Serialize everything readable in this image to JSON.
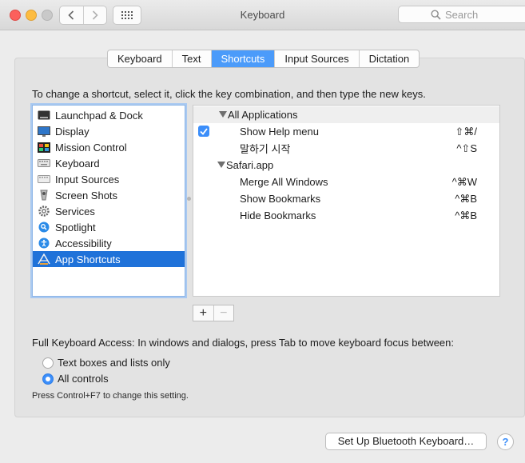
{
  "window": {
    "title": "Keyboard"
  },
  "search": {
    "placeholder": "Search"
  },
  "tabs": [
    {
      "label": "Keyboard",
      "active": false
    },
    {
      "label": "Text",
      "active": false
    },
    {
      "label": "Shortcuts",
      "active": true
    },
    {
      "label": "Input Sources",
      "active": false
    },
    {
      "label": "Dictation",
      "active": false
    }
  ],
  "instructions": "To change a shortcut, select it, click the key combination, and then type the new keys.",
  "categories": [
    {
      "label": "Launchpad & Dock",
      "icon": "launchpad-dock-icon"
    },
    {
      "label": "Display",
      "icon": "display-icon"
    },
    {
      "label": "Mission Control",
      "icon": "mission-control-icon"
    },
    {
      "label": "Keyboard",
      "icon": "keyboard-icon"
    },
    {
      "label": "Input Sources",
      "icon": "input-sources-icon"
    },
    {
      "label": "Screen Shots",
      "icon": "screen-shots-icon"
    },
    {
      "label": "Services",
      "icon": "services-gear-icon"
    },
    {
      "label": "Spotlight",
      "icon": "spotlight-icon"
    },
    {
      "label": "Accessibility",
      "icon": "accessibility-icon"
    },
    {
      "label": "App Shortcuts",
      "icon": "app-shortcuts-icon",
      "selected": true
    }
  ],
  "shortcuts": {
    "group1": {
      "name": "All Applications"
    },
    "item1": {
      "name": "Show Help menu",
      "keys": "⇧⌘/",
      "checked": true
    },
    "item2": {
      "name": "말하기 시작",
      "keys": "^⇧S"
    },
    "group2": {
      "name": "Safari.app"
    },
    "item3": {
      "name": "Merge All Windows",
      "keys": "^⌘W"
    },
    "item4": {
      "name": "Show Bookmarks",
      "keys": "^⌘B"
    },
    "item5": {
      "name": "Hide Bookmarks",
      "keys": "^⌘B"
    }
  },
  "buttons": {
    "add": "+",
    "remove": "−",
    "bluetooth": "Set Up Bluetooth Keyboard…",
    "help": "?"
  },
  "full_keyboard_access": {
    "label": "Full Keyboard Access: In windows and dialogs, press Tab to move keyboard focus between:",
    "option1": "Text boxes and lists only",
    "option2": "All controls",
    "selected": "All controls",
    "hint": "Press Control+F7 to change this setting."
  },
  "colors": {
    "accent": "#4b9bfa",
    "selection": "#1f72d9"
  }
}
